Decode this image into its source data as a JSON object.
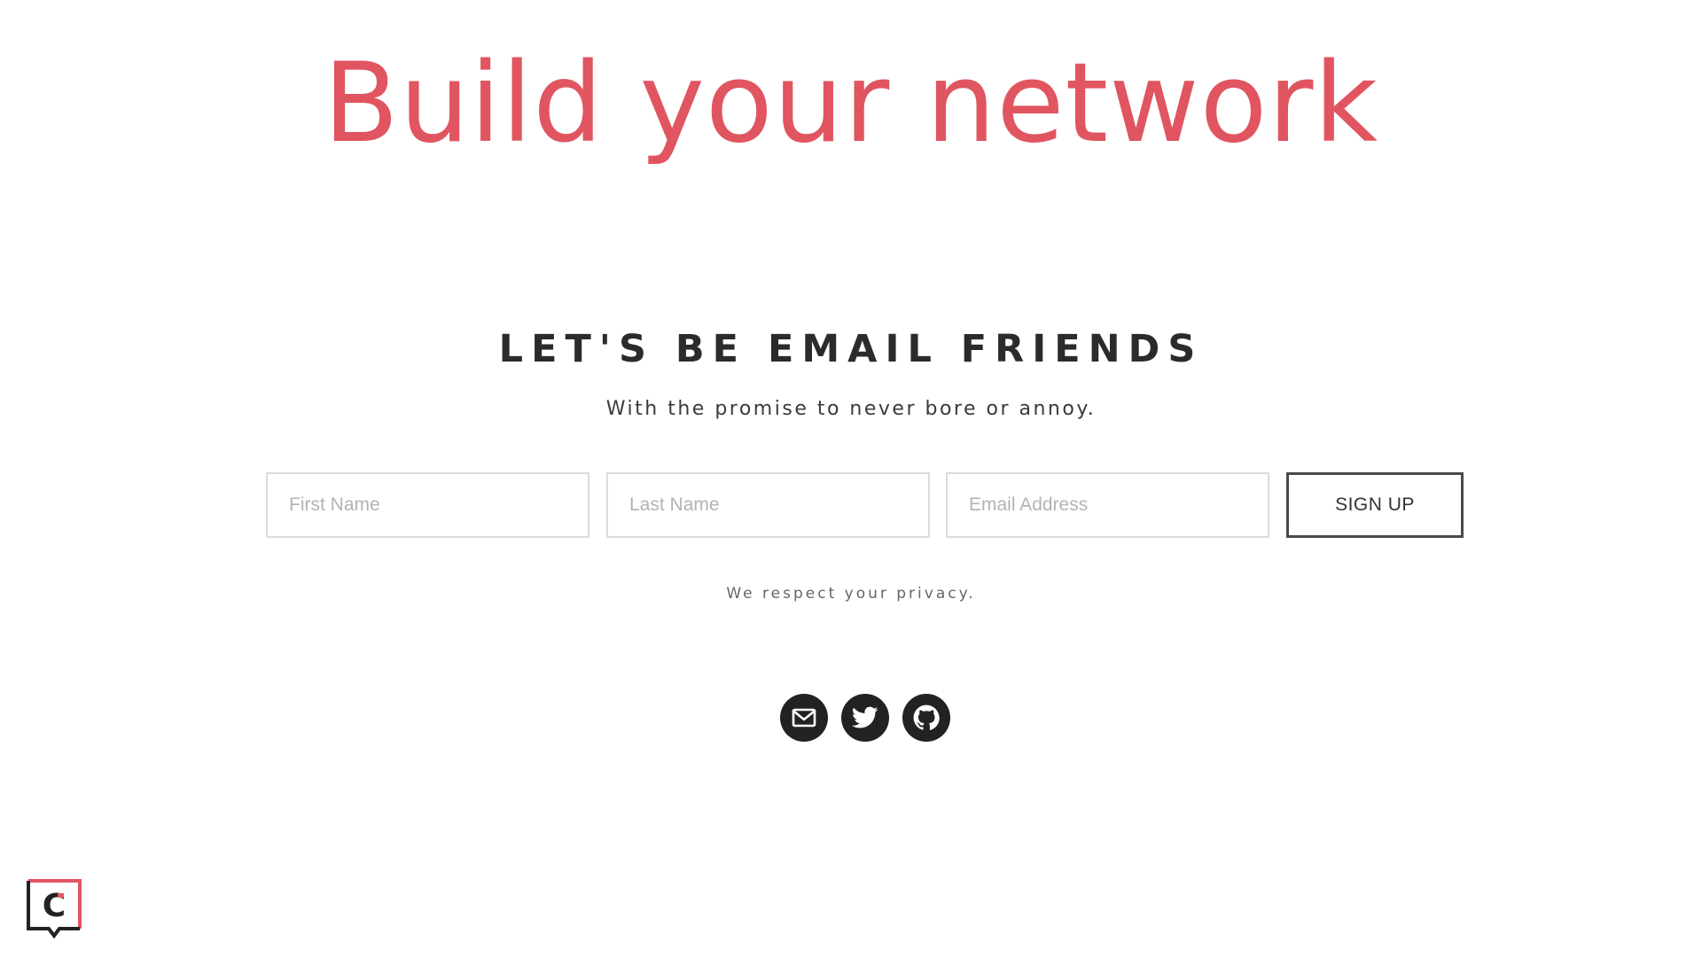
{
  "hero": {
    "title": "Build your network"
  },
  "newsletter": {
    "heading": "LET'S BE EMAIL FRIENDS",
    "subheading": "With the promise to never bore or annoy.",
    "fields": {
      "first_name_placeholder": "First Name",
      "last_name_placeholder": "Last Name",
      "email_placeholder": "Email Address"
    },
    "submit_label": "SIGN UP",
    "privacy_note": "We respect your privacy."
  },
  "social": {
    "links": [
      {
        "icon": "mail-icon",
        "label": "Email"
      },
      {
        "icon": "twitter-icon",
        "label": "Twitter"
      },
      {
        "icon": "github-icon",
        "label": "GitHub"
      }
    ]
  },
  "brand": {
    "logo_icon": "c-logo-icon",
    "logo_letter": "C"
  },
  "colors": {
    "accent": "#e05560",
    "dark": "#222222",
    "border": "#dcdcdc"
  }
}
